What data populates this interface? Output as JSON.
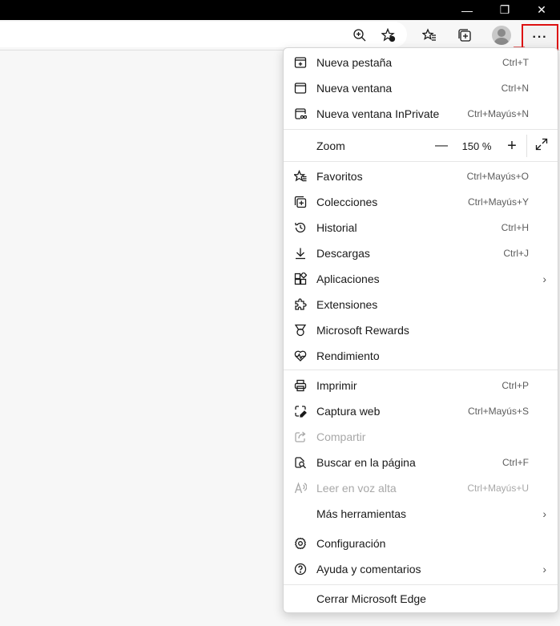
{
  "window": {
    "controls": [
      "—",
      "❐",
      "✕"
    ]
  },
  "toolbar": {
    "more_label": "···"
  },
  "zoom": {
    "label": "Zoom",
    "value": "150 %",
    "minus": "—",
    "plus": "+"
  },
  "menu": {
    "items": [
      {
        "label": "Nueva pestaña",
        "shortcut": "Ctrl+T",
        "icon": "new-tab-icon"
      },
      {
        "label": "Nueva ventana",
        "shortcut": "Ctrl+N",
        "icon": "new-window-icon"
      },
      {
        "label": "Nueva ventana InPrivate",
        "shortcut": "Ctrl+Mayús+N",
        "icon": "inprivate-icon"
      },
      {
        "label": "Favoritos",
        "shortcut": "Ctrl+Mayús+O",
        "icon": "favorites-icon"
      },
      {
        "label": "Colecciones",
        "shortcut": "Ctrl+Mayús+Y",
        "icon": "collections-icon"
      },
      {
        "label": "Historial",
        "shortcut": "Ctrl+H",
        "icon": "history-icon"
      },
      {
        "label": "Descargas",
        "shortcut": "Ctrl+J",
        "icon": "downloads-icon"
      },
      {
        "label": "Aplicaciones",
        "shortcut": "",
        "icon": "apps-icon"
      },
      {
        "label": "Extensiones",
        "shortcut": "",
        "icon": "extensions-icon"
      },
      {
        "label": "Microsoft Rewards",
        "shortcut": "",
        "icon": "rewards-icon"
      },
      {
        "label": "Rendimiento",
        "shortcut": "",
        "icon": "performance-icon"
      },
      {
        "label": "Imprimir",
        "shortcut": "Ctrl+P",
        "icon": "print-icon"
      },
      {
        "label": "Captura web",
        "shortcut": "Ctrl+Mayús+S",
        "icon": "web-capture-icon"
      },
      {
        "label": "Compartir",
        "shortcut": "",
        "icon": "share-icon"
      },
      {
        "label": "Buscar en la página",
        "shortcut": "Ctrl+F",
        "icon": "find-icon"
      },
      {
        "label": "Leer en voz alta",
        "shortcut": "Ctrl+Mayús+U",
        "icon": "read-aloud-icon"
      },
      {
        "label": "Más herramientas",
        "shortcut": "",
        "icon": ""
      },
      {
        "label": "Configuración",
        "shortcut": "",
        "icon": "settings-icon"
      },
      {
        "label": "Ayuda y comentarios",
        "shortcut": "",
        "icon": "help-icon"
      },
      {
        "label": "Cerrar Microsoft Edge",
        "shortcut": "",
        "icon": ""
      }
    ]
  },
  "colors": {
    "highlight_border": "#dd1111",
    "arrow": "#dd1111"
  }
}
